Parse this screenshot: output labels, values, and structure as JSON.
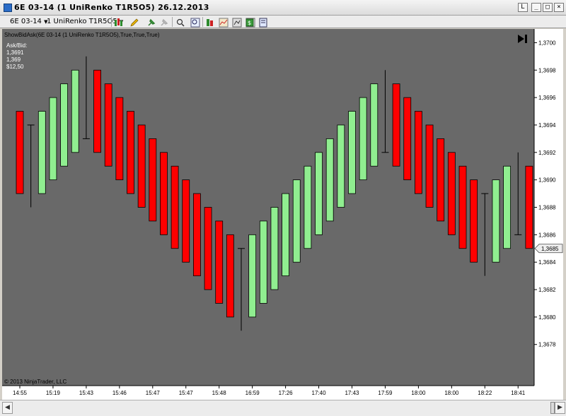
{
  "window": {
    "title": "6E 03-14 (1 UniRenko T1R5O5)  26.12.2013",
    "buttons": {
      "help": "L",
      "minimize": "_",
      "maximize": "□",
      "close": "×"
    }
  },
  "toolbar": {
    "instrument": "6E 03-14",
    "interval": "1 UniRenko T1R5O5",
    "icons": [
      "bar-style-icon",
      "pencil-draw-icon",
      "pin-icon",
      "pin-disabled-icon",
      "zoom-icon",
      "search-icon",
      "strategy-icon",
      "indicators-icon",
      "chart-properties-icon",
      "data-box-icon",
      "cash-icon",
      "templates-icon"
    ]
  },
  "chart": {
    "indicator_label": "ShowBidAsk(6E 03-14 (1 UniRenko T1R5O5),True,True,True)",
    "ask_bid_title": "Ask/Bid:",
    "ask": "1,3691",
    "bid": "1,369",
    "value": "$12,50",
    "copyright": "© 2013 NinjaTrader, LLC",
    "current_price_label": "1,3685",
    "colors": {
      "background": "#696969",
      "up": "#90ee90",
      "down": "#ff0000",
      "wick": "#000000",
      "axis_bg": "#ffffff"
    }
  },
  "chart_data": {
    "type": "candlestick",
    "ylim": [
      1.3675,
      1.3701
    ],
    "y_ticks": [
      "1,3678",
      "1,3680",
      "1,3682",
      "1,3684",
      "1,3686",
      "1,3688",
      "1,3690",
      "1,3692",
      "1,3694",
      "1,3696",
      "1,3698",
      "1,3700"
    ],
    "x_ticks": [
      "14:55",
      "15:19",
      "15:43",
      "15:46",
      "15:47",
      "15:47",
      "15:48",
      "16:59",
      "17:26",
      "17:40",
      "17:43",
      "17:59",
      "18:00",
      "18:00",
      "18:22",
      "18:41"
    ],
    "candles": [
      {
        "o": 1.3695,
        "c": 1.3689,
        "h": 1.3695,
        "l": 1.3689
      },
      {
        "o": 1.3694,
        "c": 1.3694,
        "h": 1.3694,
        "l": 1.3688
      },
      {
        "o": 1.3689,
        "c": 1.3695,
        "h": 1.3695,
        "l": 1.3689
      },
      {
        "o": 1.369,
        "c": 1.3696,
        "h": 1.3696,
        "l": 1.369
      },
      {
        "o": 1.3691,
        "c": 1.3697,
        "h": 1.3697,
        "l": 1.3691
      },
      {
        "o": 1.3692,
        "c": 1.3698,
        "h": 1.3698,
        "l": 1.3692
      },
      {
        "o": 1.3693,
        "c": 1.3693,
        "h": 1.3699,
        "l": 1.3693
      },
      {
        "o": 1.3698,
        "c": 1.3692,
        "h": 1.3698,
        "l": 1.3692
      },
      {
        "o": 1.3697,
        "c": 1.3691,
        "h": 1.3697,
        "l": 1.3691
      },
      {
        "o": 1.3696,
        "c": 1.369,
        "h": 1.3696,
        "l": 1.369
      },
      {
        "o": 1.3695,
        "c": 1.3689,
        "h": 1.3695,
        "l": 1.3689
      },
      {
        "o": 1.3694,
        "c": 1.3688,
        "h": 1.3694,
        "l": 1.3688
      },
      {
        "o": 1.3693,
        "c": 1.3687,
        "h": 1.3693,
        "l": 1.3687
      },
      {
        "o": 1.3692,
        "c": 1.3686,
        "h": 1.3692,
        "l": 1.3686
      },
      {
        "o": 1.3691,
        "c": 1.3685,
        "h": 1.3691,
        "l": 1.3685
      },
      {
        "o": 1.369,
        "c": 1.3684,
        "h": 1.369,
        "l": 1.3684
      },
      {
        "o": 1.3689,
        "c": 1.3683,
        "h": 1.3689,
        "l": 1.3683
      },
      {
        "o": 1.3688,
        "c": 1.3682,
        "h": 1.3688,
        "l": 1.3682
      },
      {
        "o": 1.3687,
        "c": 1.3681,
        "h": 1.3687,
        "l": 1.3681
      },
      {
        "o": 1.3686,
        "c": 1.368,
        "h": 1.3686,
        "l": 1.368
      },
      {
        "o": 1.3685,
        "c": 1.3685,
        "h": 1.3685,
        "l": 1.3679
      },
      {
        "o": 1.368,
        "c": 1.3686,
        "h": 1.3686,
        "l": 1.368
      },
      {
        "o": 1.3681,
        "c": 1.3687,
        "h": 1.3687,
        "l": 1.3681
      },
      {
        "o": 1.3682,
        "c": 1.3688,
        "h": 1.3688,
        "l": 1.3682
      },
      {
        "o": 1.3683,
        "c": 1.3689,
        "h": 1.3689,
        "l": 1.3683
      },
      {
        "o": 1.3684,
        "c": 1.369,
        "h": 1.369,
        "l": 1.3684
      },
      {
        "o": 1.3685,
        "c": 1.3691,
        "h": 1.3691,
        "l": 1.3685
      },
      {
        "o": 1.3686,
        "c": 1.3692,
        "h": 1.3692,
        "l": 1.3686
      },
      {
        "o": 1.3687,
        "c": 1.3693,
        "h": 1.3693,
        "l": 1.3687
      },
      {
        "o": 1.3688,
        "c": 1.3694,
        "h": 1.3694,
        "l": 1.3688
      },
      {
        "o": 1.3689,
        "c": 1.3695,
        "h": 1.3695,
        "l": 1.3689
      },
      {
        "o": 1.369,
        "c": 1.3696,
        "h": 1.3696,
        "l": 1.369
      },
      {
        "o": 1.3691,
        "c": 1.3697,
        "h": 1.3697,
        "l": 1.3691
      },
      {
        "o": 1.3692,
        "c": 1.3692,
        "h": 1.3698,
        "l": 1.3692
      },
      {
        "o": 1.3697,
        "c": 1.3691,
        "h": 1.3697,
        "l": 1.3691
      },
      {
        "o": 1.3696,
        "c": 1.369,
        "h": 1.3696,
        "l": 1.369
      },
      {
        "o": 1.3695,
        "c": 1.3689,
        "h": 1.3695,
        "l": 1.3689
      },
      {
        "o": 1.3694,
        "c": 1.3688,
        "h": 1.3694,
        "l": 1.3688
      },
      {
        "o": 1.3693,
        "c": 1.3687,
        "h": 1.3693,
        "l": 1.3687
      },
      {
        "o": 1.3692,
        "c": 1.3686,
        "h": 1.3692,
        "l": 1.3686
      },
      {
        "o": 1.3691,
        "c": 1.3685,
        "h": 1.3691,
        "l": 1.3685
      },
      {
        "o": 1.369,
        "c": 1.3684,
        "h": 1.369,
        "l": 1.3684
      },
      {
        "o": 1.3689,
        "c": 1.3689,
        "h": 1.3689,
        "l": 1.3683
      },
      {
        "o": 1.3684,
        "c": 1.369,
        "h": 1.369,
        "l": 1.3684
      },
      {
        "o": 1.3685,
        "c": 1.3691,
        "h": 1.3691,
        "l": 1.3685
      },
      {
        "o": 1.3686,
        "c": 1.3686,
        "h": 1.3692,
        "l": 1.3686
      },
      {
        "o": 1.3691,
        "c": 1.3685,
        "h": 1.3691,
        "l": 1.3685
      }
    ]
  }
}
